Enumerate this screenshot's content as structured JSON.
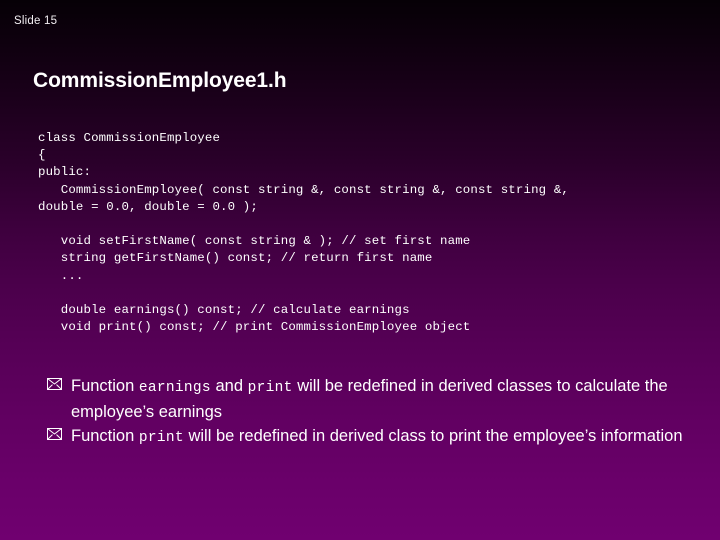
{
  "slide": {
    "number_label": "Slide 15",
    "title": "CommissionEmployee1.h",
    "background": {
      "top_color": "#060006",
      "mid_color": "#4a004a",
      "bottom_color": "#700070"
    },
    "text_color": "#ffffff"
  },
  "code": {
    "lines": [
      "class CommissionEmployee",
      "{",
      "public:",
      "   CommissionEmployee( const string &, const string &, const string &,",
      "double = 0.0, double = 0.0 );",
      "",
      "   void setFirstName( const string & ); // set first name",
      "   string getFirstName() const; // return first name",
      "   ...",
      "",
      "   double earnings() const; // calculate earnings",
      "   void print() const; // print CommissionEmployee object"
    ]
  },
  "bullets": {
    "marker_icon": "envelope-icon",
    "items": [
      {
        "segments": [
          {
            "text": "Function ",
            "mono": false
          },
          {
            "text": "earnings",
            "mono": true
          },
          {
            "text": " and ",
            "mono": false
          },
          {
            "text": "print",
            "mono": true
          },
          {
            "text": " will be redefined in derived classes to calculate the employee’s earnings",
            "mono": false
          }
        ]
      },
      {
        "segments": [
          {
            "text": "Function ",
            "mono": false
          },
          {
            "text": "print",
            "mono": true
          },
          {
            "text": " will be redefined in derived class to print the employee’s information",
            "mono": false
          }
        ]
      }
    ]
  }
}
